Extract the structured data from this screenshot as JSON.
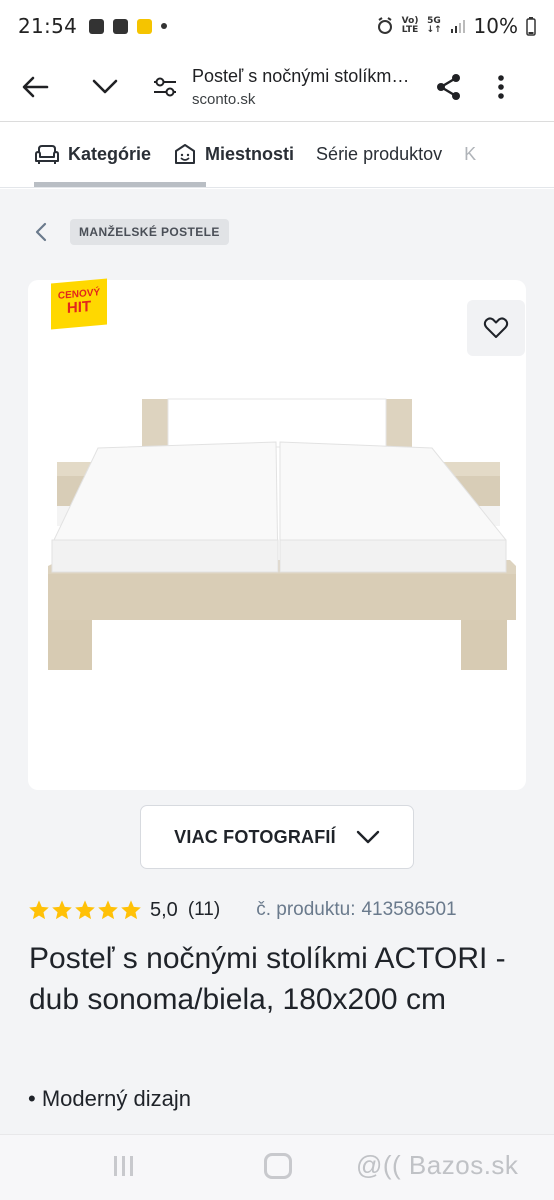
{
  "status_bar": {
    "time": "21:54",
    "network_top": "Vo)",
    "network_bottom": "LTE",
    "gen_top": "5G",
    "battery": "10%"
  },
  "browser": {
    "title": "Posteľ s nočnými stolíkmi ACTORI - dub sonoma/biela, 180x200 cm",
    "url": "sconto.sk"
  },
  "category_tabs": [
    {
      "label": "Kategórie",
      "icon": "armchair-icon"
    },
    {
      "label": "Miestnosti",
      "icon": "face-icon"
    },
    {
      "label": "Série produktov"
    },
    {
      "label": "K"
    }
  ],
  "breadcrumb": {
    "label": "MANŽELSKÉ POSTELE"
  },
  "badge": {
    "top": "CENOVÝ",
    "bottom": "HIT"
  },
  "gallery": {
    "more_label": "VIAC FOTOGRAFIÍ"
  },
  "rating": {
    "stars": 5,
    "value": "5,0",
    "count": "(11)"
  },
  "product": {
    "code_label": "č. produktu:",
    "code": "413586501",
    "title": "Posteľ s nočnými stolíkmi ACTORI - dub sonoma/biela, 180x200 cm",
    "features": [
      "• Moderný dizajn"
    ]
  },
  "watermark": "@(( Bazos.sk",
  "colors": {
    "star": "#ffc107",
    "badge_bg": "#ffd800",
    "badge_text": "#e2261c",
    "page_bg": "#f3f4f6",
    "code_text": "#6a7a8c"
  }
}
